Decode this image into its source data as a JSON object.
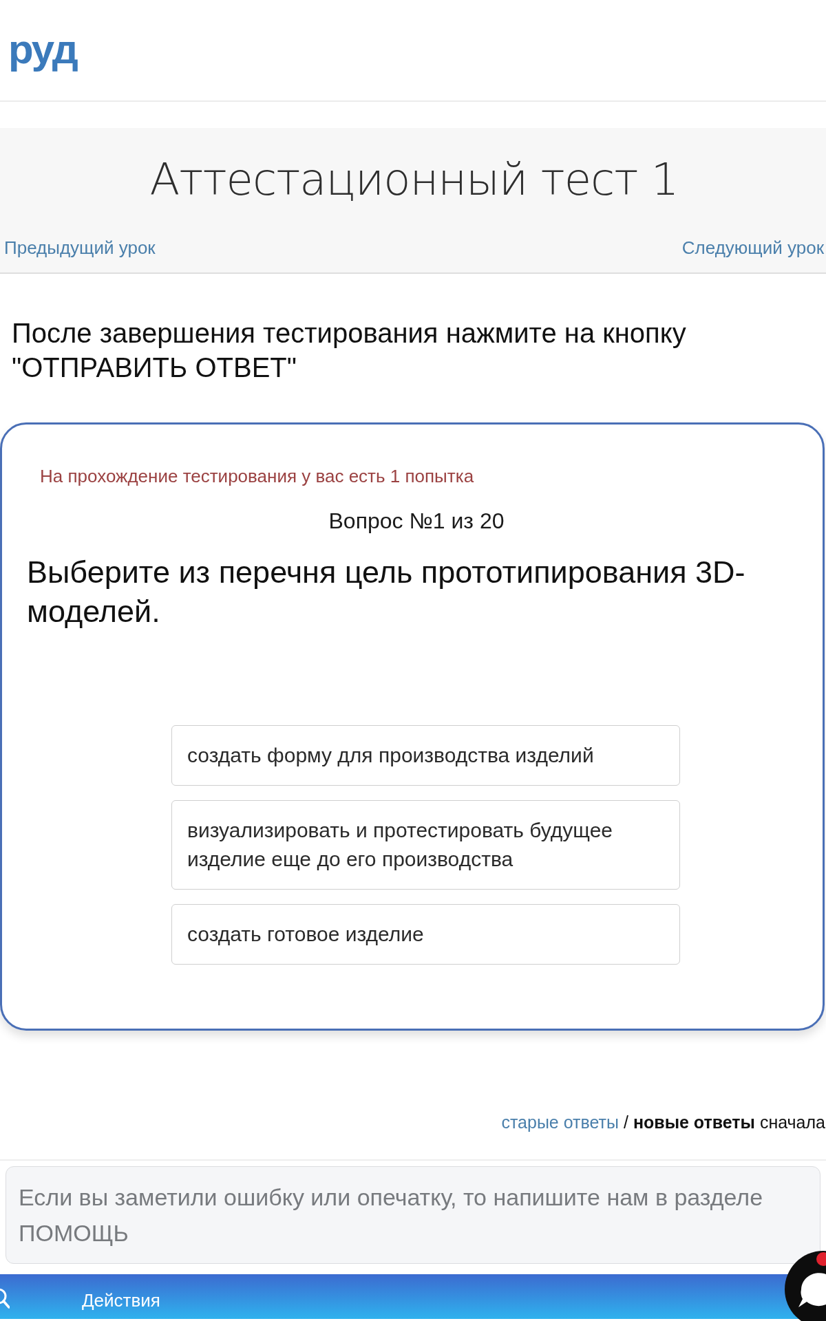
{
  "header": {
    "logo": "руд"
  },
  "lesson": {
    "title": "Аттестационный тест 1",
    "prev_link": "Предыдущий урок",
    "next_link": "Следующий урок"
  },
  "instruction": "После завершения тестирования нажмите на кнопку \"ОТПРАВИТЬ ОТВЕТ\"",
  "quiz": {
    "attempts_note": "На прохождение тестирования у вас есть 1 попытка",
    "counter": "Вопрос №1 из 20",
    "question": "Выберите из перечня цель прототипирования 3D-моделей.",
    "options": [
      {
        "text": "создать форму для производства изделий",
        "selected": false
      },
      {
        "text": "визуализировать и протестировать будущее изделие еще до его производства",
        "selected": false
      },
      {
        "text": "создать готовое изделие",
        "selected": false
      }
    ]
  },
  "comments": {
    "sort_link": "старые ответы",
    "sort_rest": "/ **новые ответы** сначала"
  },
  "feedback_field": {
    "placeholder": "Если вы заметили ошибку или опечатку, то напишите нам в разделе ПОМОЩЬ"
  },
  "bottom_bar": {
    "label": "Действия"
  }
}
